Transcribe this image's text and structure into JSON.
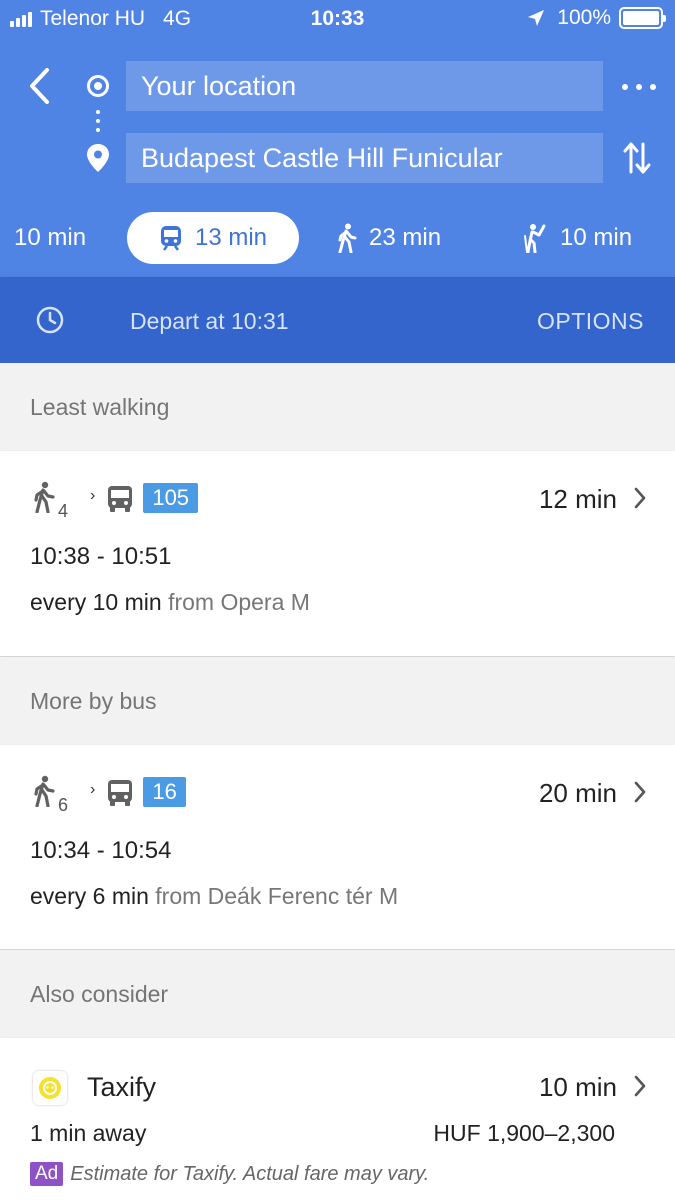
{
  "status_bar": {
    "carrier": "Telenor HU",
    "network": "4G",
    "time": "10:33",
    "battery": "100%",
    "battery_level": 1.0,
    "signal_bars": 4
  },
  "search": {
    "origin": "Your location",
    "destination": "Budapest Castle Hill Funicular"
  },
  "modes": [
    {
      "label": "10 min",
      "icon": "car-icon",
      "selected": false
    },
    {
      "label": "13 min",
      "icon": "transit-icon",
      "selected": true
    },
    {
      "label": "23 min",
      "icon": "walk-icon",
      "selected": false
    },
    {
      "label": "10 min",
      "icon": "ride-hailing-icon",
      "selected": false
    }
  ],
  "depart": {
    "label": "Depart at 10:31",
    "options_label": "OPTIONS"
  },
  "sections": {
    "least_walking": "Least walking",
    "more_by_bus": "More by bus",
    "also_consider": "Also consider"
  },
  "routes": [
    {
      "walk_minutes": "4",
      "line": "105",
      "duration": "12 min",
      "times": "10:38 - 10:51",
      "frequency": "every 10 min",
      "from": "from Opera M"
    },
    {
      "walk_minutes": "6",
      "line": "16",
      "duration": "20 min",
      "times": "10:34 - 10:54",
      "frequency": "every 6 min",
      "from": "from Deák Ferenc tér M"
    }
  ],
  "taxi": {
    "name": "Taxify",
    "duration": "10 min",
    "away": "1 min away",
    "fare": "HUF 1,900–2,300",
    "ad_badge": "Ad",
    "ad_text": "Estimate for Taxify. Actual fare may vary."
  },
  "colors": {
    "header_blue": "#4f83e4",
    "depart_bar_blue": "#3465cc",
    "line_badge_blue": "#4a9be4",
    "ad_purple": "#8e52c4",
    "taxify_yellow": "#f5e02a"
  }
}
